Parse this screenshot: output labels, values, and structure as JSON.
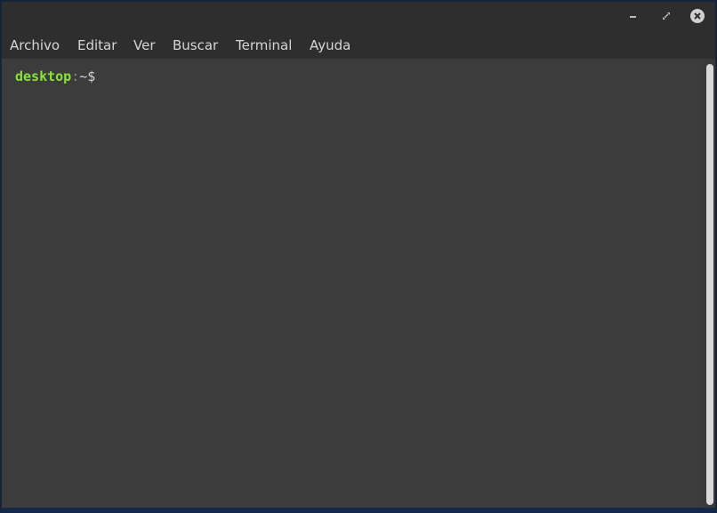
{
  "window": {
    "controls": {
      "minimize_icon": "minimize-icon",
      "maximize_icon": "maximize-icon",
      "close_icon": "close-icon"
    }
  },
  "menubar": {
    "items": [
      {
        "label": "Archivo"
      },
      {
        "label": "Editar"
      },
      {
        "label": "Ver"
      },
      {
        "label": "Buscar"
      },
      {
        "label": "Terminal"
      },
      {
        "label": "Ayuda"
      }
    ]
  },
  "terminal": {
    "prompt": {
      "host": "desktop",
      "separator": ":",
      "path": "~",
      "symbol": "$"
    }
  },
  "colors": {
    "prompt_host": "#8ae234",
    "terminal_background": "#3c3c3c",
    "titlebar": "#2e2e2e",
    "menu_text": "#d6d6d6"
  }
}
